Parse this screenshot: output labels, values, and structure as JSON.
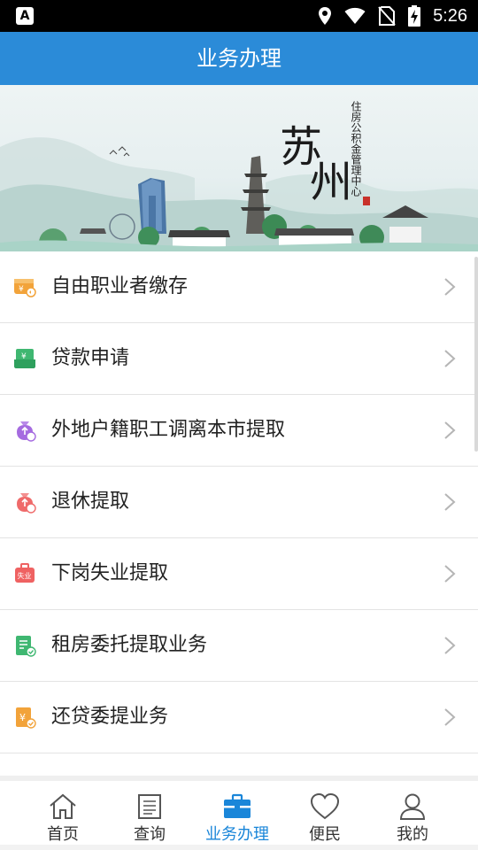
{
  "status_bar": {
    "left_icon": "A",
    "time": "5:26",
    "icons": [
      "location-icon",
      "wifi-icon",
      "no-sim-icon",
      "battery-charging-icon"
    ]
  },
  "header": {
    "title": "业务办理"
  },
  "banner": {
    "calligraphy": [
      "苏",
      "州"
    ],
    "subtitle": "住房公积金管理中心"
  },
  "menu": {
    "items": [
      {
        "label": "自由职业者缴存",
        "icon": "wallet-yuan-icon",
        "color": "#f2a33a"
      },
      {
        "label": "贷款申请",
        "icon": "yuan-card-icon",
        "color": "#3fb771"
      },
      {
        "label": "外地户籍职工调离本市提取",
        "icon": "purple-bag-icon",
        "color": "#a56be0"
      },
      {
        "label": "退休提取",
        "icon": "red-bag-icon",
        "color": "#ef6a6a"
      },
      {
        "label": "下岗失业提取",
        "icon": "briefcase-unemployed-icon",
        "color": "#ef6262",
        "badge_text": "失业"
      },
      {
        "label": "租房委托提取业务",
        "icon": "document-check-icon",
        "color": "#3fb771"
      },
      {
        "label": "还贷委提业务",
        "icon": "yuan-doc-icon",
        "color": "#f2a33a"
      }
    ]
  },
  "bottom_nav": {
    "active_color": "#1a86d9",
    "items": [
      {
        "label": "首页",
        "icon": "home-icon"
      },
      {
        "label": "查询",
        "icon": "list-document-icon"
      },
      {
        "label": "业务办理",
        "icon": "briefcase-icon",
        "active": true
      },
      {
        "label": "便民",
        "icon": "heart-icon"
      },
      {
        "label": "我的",
        "icon": "user-icon"
      }
    ]
  }
}
